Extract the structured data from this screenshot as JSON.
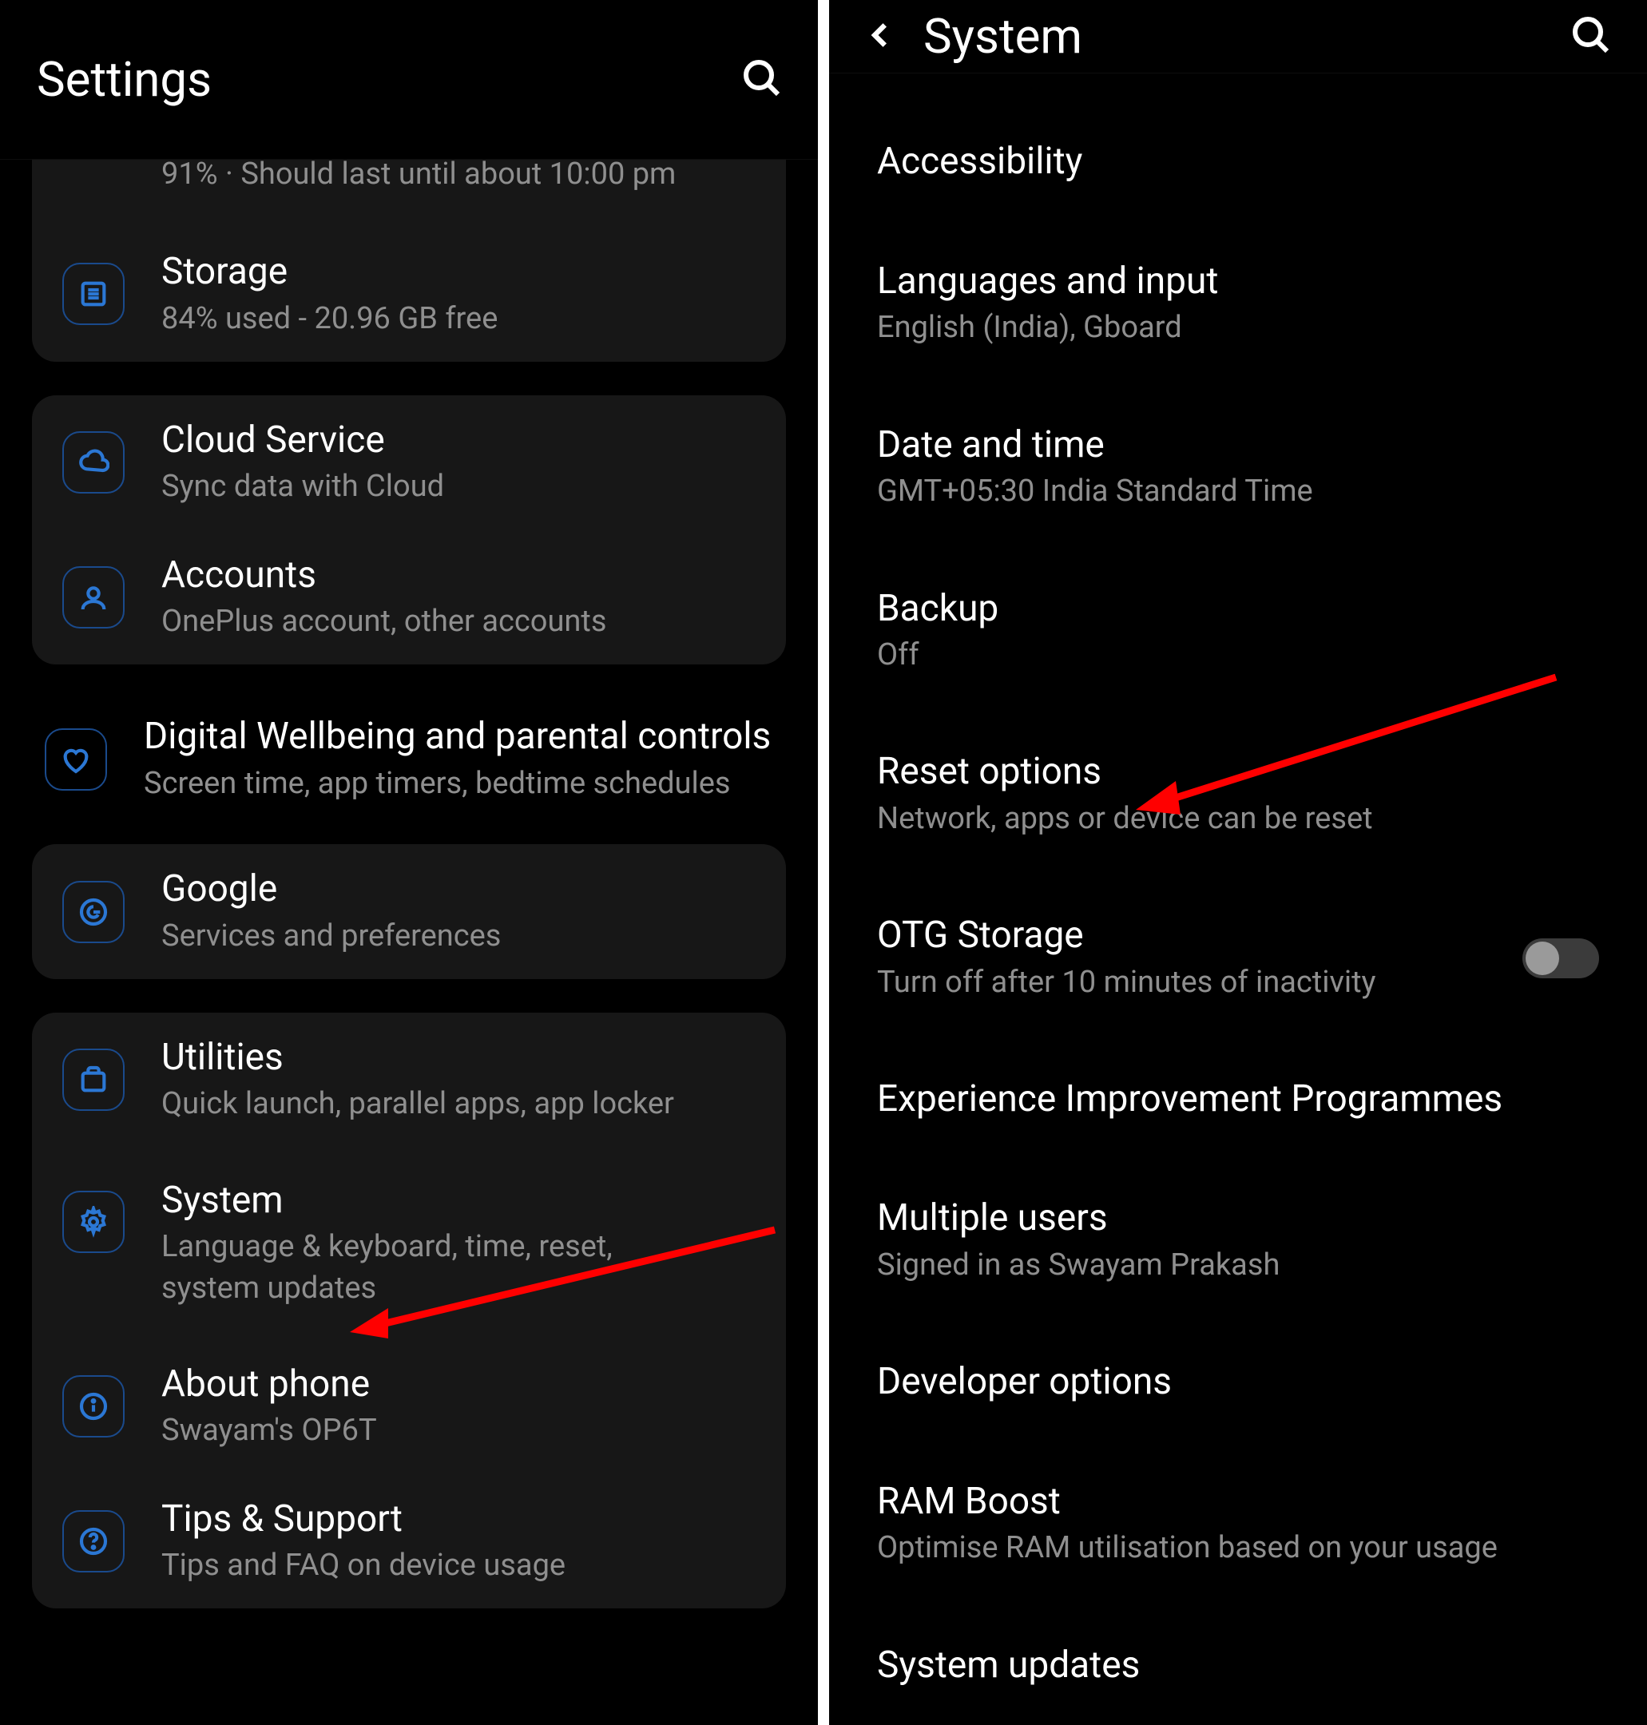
{
  "leftPane": {
    "title": "Settings",
    "cutoffBattery": "91% · Should last until about 10:00 pm",
    "groups": [
      {
        "type": "card-cut-top",
        "items": [
          {
            "icon": "storage",
            "title": "Storage",
            "subtitle": "84% used - 20.96 GB free"
          }
        ]
      },
      {
        "type": "card",
        "items": [
          {
            "icon": "cloud",
            "title": "Cloud Service",
            "subtitle": "Sync data with Cloud"
          },
          {
            "icon": "account",
            "title": "Accounts",
            "subtitle": "OnePlus account, other accounts"
          }
        ]
      },
      {
        "type": "plain",
        "items": [
          {
            "icon": "heart",
            "title": "Digital Wellbeing and parental controls",
            "subtitle": "Screen time, app timers, bedtime schedules"
          }
        ]
      },
      {
        "type": "card",
        "items": [
          {
            "icon": "google",
            "title": "Google",
            "subtitle": "Services and preferences"
          }
        ]
      },
      {
        "type": "card",
        "items": [
          {
            "icon": "utilities",
            "title": "Utilities",
            "subtitle": "Quick launch, parallel apps, app locker"
          },
          {
            "icon": "gear",
            "title": "System",
            "subtitle": "Language & keyboard, time, reset, system updates"
          },
          {
            "icon": "info",
            "title": "About phone",
            "subtitle": "Swayam's OP6T"
          },
          {
            "icon": "help",
            "title": "Tips & Support",
            "subtitle": "Tips and FAQ on device usage"
          }
        ]
      }
    ]
  },
  "rightPane": {
    "title": "System",
    "items": [
      {
        "title": "Accessibility",
        "subtitle": ""
      },
      {
        "title": "Languages and input",
        "subtitle": "English (India), Gboard"
      },
      {
        "title": "Date and time",
        "subtitle": "GMT+05:30 India Standard Time"
      },
      {
        "title": "Backup",
        "subtitle": "Off"
      },
      {
        "title": "Reset options",
        "subtitle": "Network, apps or device can be reset"
      },
      {
        "title": "OTG Storage",
        "subtitle": "Turn off after 10 minutes of inactivity",
        "hasToggle": true,
        "toggleOn": false
      },
      {
        "title": "Experience Improvement Programmes",
        "subtitle": ""
      },
      {
        "title": "Multiple users",
        "subtitle": "Signed in as Swayam Prakash"
      },
      {
        "title": "Developer options",
        "subtitle": ""
      },
      {
        "title": "RAM Boost",
        "subtitle": "Optimise RAM utilisation based on your usage"
      },
      {
        "title": "System updates",
        "subtitle": ""
      }
    ]
  }
}
